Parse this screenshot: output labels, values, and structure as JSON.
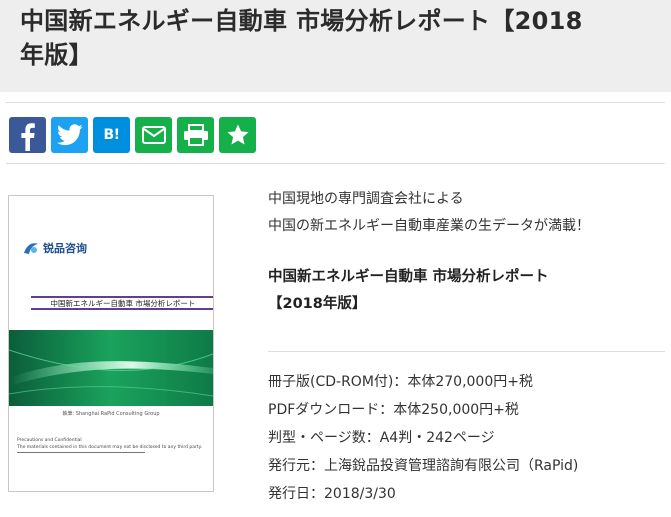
{
  "page": {
    "title_line1": "中国新エネルギー自動車 市場分析レポート【2018",
    "title_line2": "年版】"
  },
  "share": {
    "buttons": [
      {
        "name": "facebook-share-button",
        "icon": "facebook-icon",
        "color": "#3b5998"
      },
      {
        "name": "twitter-share-button",
        "icon": "twitter-icon",
        "color": "#1da1f2"
      },
      {
        "name": "hatena-bookmark-button",
        "icon": "hatena-bookmark-icon",
        "label": "B!",
        "color": "#008fde"
      },
      {
        "name": "mail-share-button",
        "icon": "mail-icon",
        "color": "#16b04b"
      },
      {
        "name": "print-button",
        "icon": "printer-icon",
        "color": "#16b04b"
      },
      {
        "name": "favorite-button",
        "icon": "star-icon",
        "color": "#16b04b"
      }
    ]
  },
  "cover": {
    "logo_text": "锐品咨询",
    "band_text": "中国新エネルギー自動車 市場分析レポート",
    "group_text": "執筆: Shanghai RaPid Consulting Group",
    "legal_line1": "Precautions and Confidential",
    "legal_line2": "The materials contained in this document may not be disclosed to any third party."
  },
  "description": {
    "intro_line1": "中国現地の専門調査会社による",
    "intro_line2": "中国の新エネルギー自動車産業の生データが満載！",
    "product_title_line1": "中国新エネルギー自動車 市場分析レポート",
    "product_title_line2": "【2018年版】",
    "details": [
      "冊子版(CD-ROM付)：本体270,000円+税",
      "PDFダウンロード：本体250,000円+税",
      "判型・ページ数：A4判・242ページ",
      "発行元：上海銳品投資管理諮詢有限公司（RaPid)",
      "発行日：2018/3/30"
    ]
  }
}
